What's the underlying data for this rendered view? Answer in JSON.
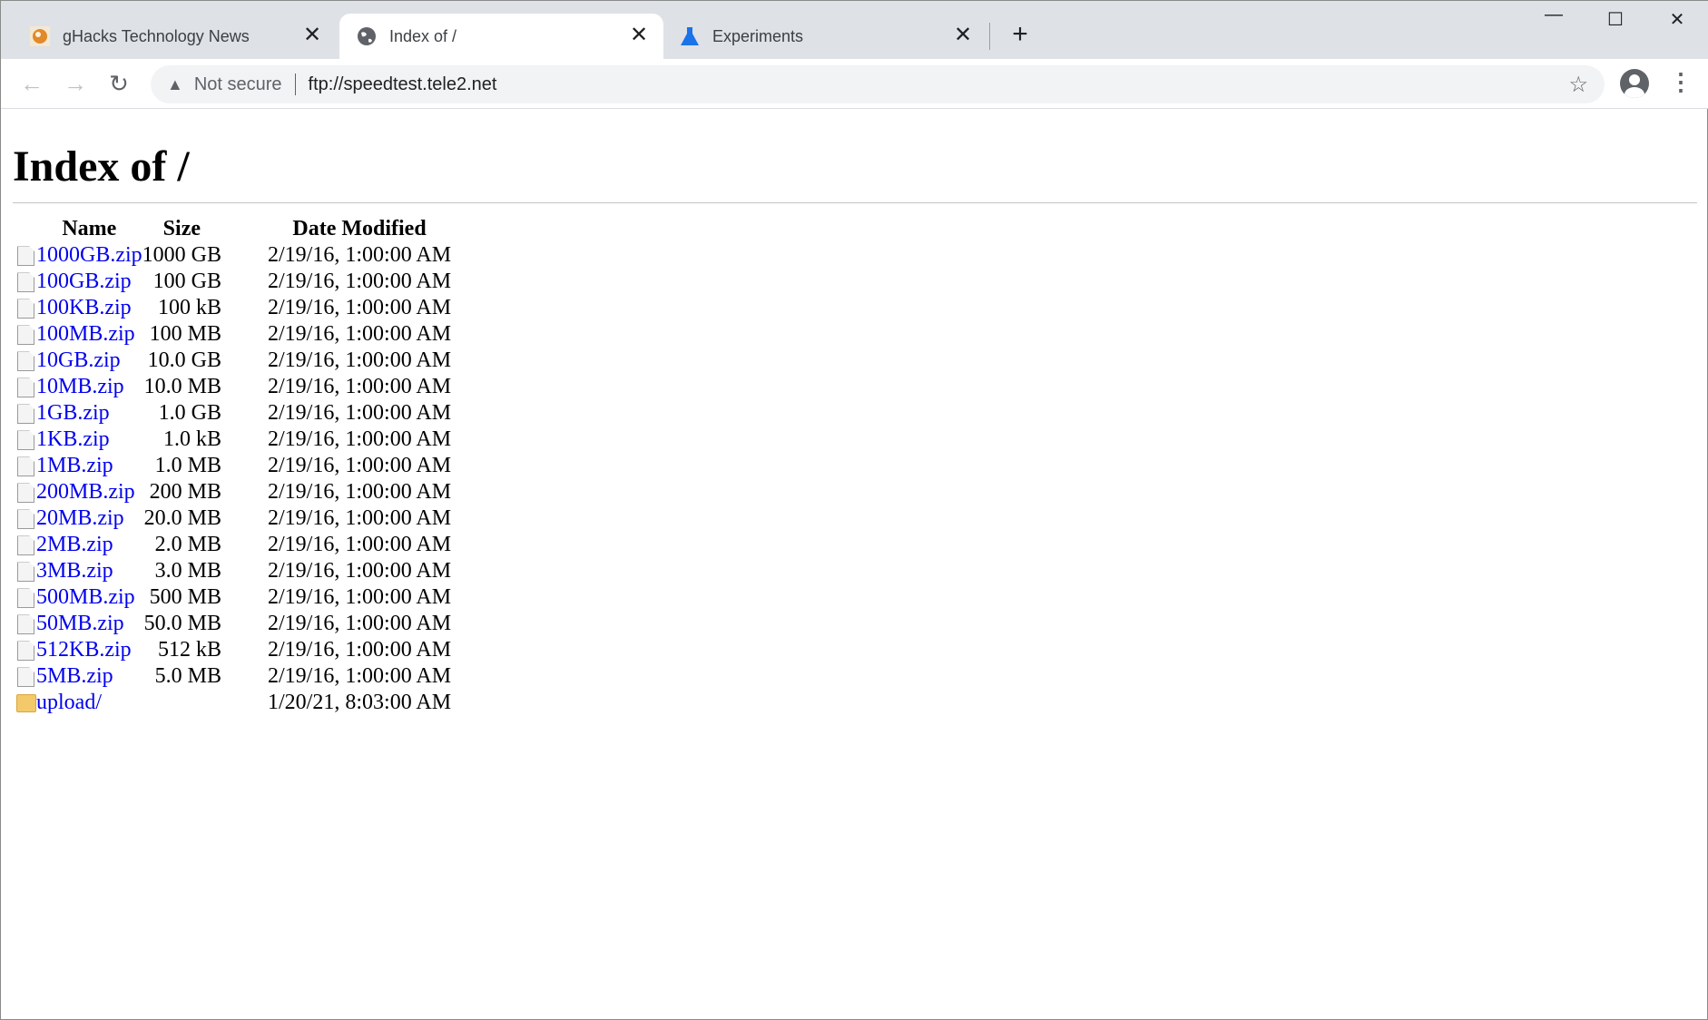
{
  "tabs": [
    {
      "title": "gHacks Technology News",
      "icon": "ghacks-favicon",
      "active": false
    },
    {
      "title": "Index of /",
      "icon": "globe-icon",
      "active": true
    },
    {
      "title": "Experiments",
      "icon": "flask-icon",
      "active": false
    }
  ],
  "toolbar": {
    "security_label": "Not secure",
    "url": "ftp://speedtest.tele2.net"
  },
  "page": {
    "title": "Index of /",
    "columns": [
      "Name",
      "Size",
      "Date Modified"
    ],
    "rows": [
      {
        "name": "1000GB.zip",
        "size": "1000 GB",
        "date": "2/19/16, 1:00:00 AM",
        "type": "file"
      },
      {
        "name": "100GB.zip",
        "size": "100 GB",
        "date": "2/19/16, 1:00:00 AM",
        "type": "file"
      },
      {
        "name": "100KB.zip",
        "size": "100 kB",
        "date": "2/19/16, 1:00:00 AM",
        "type": "file"
      },
      {
        "name": "100MB.zip",
        "size": "100 MB",
        "date": "2/19/16, 1:00:00 AM",
        "type": "file"
      },
      {
        "name": "10GB.zip",
        "size": "10.0 GB",
        "date": "2/19/16, 1:00:00 AM",
        "type": "file"
      },
      {
        "name": "10MB.zip",
        "size": "10.0 MB",
        "date": "2/19/16, 1:00:00 AM",
        "type": "file"
      },
      {
        "name": "1GB.zip",
        "size": "1.0 GB",
        "date": "2/19/16, 1:00:00 AM",
        "type": "file"
      },
      {
        "name": "1KB.zip",
        "size": "1.0 kB",
        "date": "2/19/16, 1:00:00 AM",
        "type": "file"
      },
      {
        "name": "1MB.zip",
        "size": "1.0 MB",
        "date": "2/19/16, 1:00:00 AM",
        "type": "file"
      },
      {
        "name": "200MB.zip",
        "size": "200 MB",
        "date": "2/19/16, 1:00:00 AM",
        "type": "file"
      },
      {
        "name": "20MB.zip",
        "size": "20.0 MB",
        "date": "2/19/16, 1:00:00 AM",
        "type": "file"
      },
      {
        "name": "2MB.zip",
        "size": "2.0 MB",
        "date": "2/19/16, 1:00:00 AM",
        "type": "file"
      },
      {
        "name": "3MB.zip",
        "size": "3.0 MB",
        "date": "2/19/16, 1:00:00 AM",
        "type": "file"
      },
      {
        "name": "500MB.zip",
        "size": "500 MB",
        "date": "2/19/16, 1:00:00 AM",
        "type": "file"
      },
      {
        "name": "50MB.zip",
        "size": "50.0 MB",
        "date": "2/19/16, 1:00:00 AM",
        "type": "file"
      },
      {
        "name": "512KB.zip",
        "size": "512 kB",
        "date": "2/19/16, 1:00:00 AM",
        "type": "file"
      },
      {
        "name": "5MB.zip",
        "size": "5.0 MB",
        "date": "2/19/16, 1:00:00 AM",
        "type": "file"
      },
      {
        "name": "upload/",
        "size": "",
        "date": "1/20/21, 8:03:00 AM",
        "type": "folder"
      }
    ]
  },
  "colors": {
    "link": "#0000ee",
    "tabstrip": "#dee1e6",
    "omnibox": "#f1f3f4",
    "flask": "#1a73e8"
  }
}
